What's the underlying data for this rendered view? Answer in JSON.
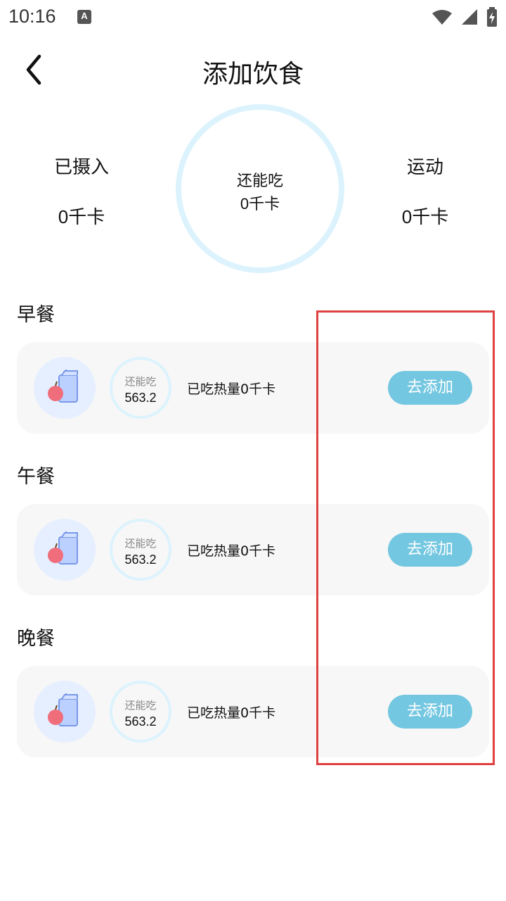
{
  "status_bar": {
    "time": "10:16",
    "notif_letter": "A"
  },
  "header": {
    "title": "添加饮食"
  },
  "summary": {
    "intake_label": "已摄入",
    "intake_value": "0千卡",
    "remaining_label": "还能吃",
    "remaining_value": "0千卡",
    "exercise_label": "运动",
    "exercise_value": "0千卡"
  },
  "meals": [
    {
      "title": "早餐",
      "ring_label": "还能吃",
      "ring_value": "563.2",
      "eaten": "已吃热量0千卡",
      "button": "去添加"
    },
    {
      "title": "午餐",
      "ring_label": "还能吃",
      "ring_value": "563.2",
      "eaten": "已吃热量0千卡",
      "button": "去添加"
    },
    {
      "title": "晚餐",
      "ring_label": "还能吃",
      "ring_value": "563.2",
      "eaten": "已吃热量0千卡",
      "button": "去添加"
    }
  ],
  "colors": {
    "accent": "#74c7e1",
    "ring": "#dcf3fd",
    "card": "#f7f7f7",
    "highlight": "#e04040"
  }
}
